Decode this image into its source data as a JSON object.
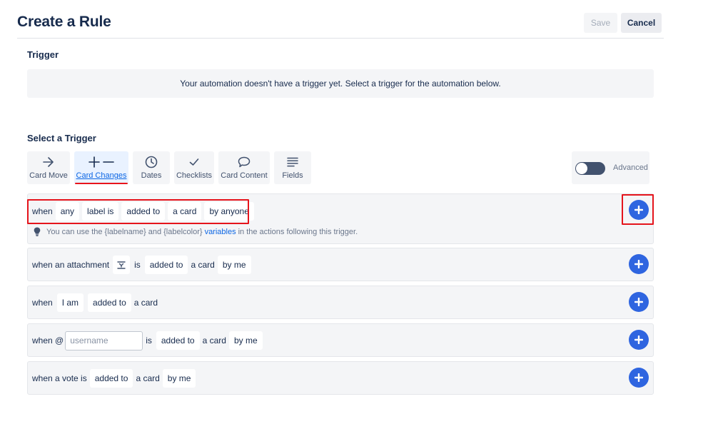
{
  "header": {
    "title": "Create a Rule",
    "save_label": "Save",
    "cancel_label": "Cancel"
  },
  "trigger": {
    "heading": "Trigger",
    "empty_message": "Your automation doesn't have a trigger yet. Select a trigger for the automation below."
  },
  "select_trigger": {
    "heading": "Select a Trigger",
    "tabs": [
      {
        "label": "Card Move",
        "icon": "arrow-right-icon",
        "active": false
      },
      {
        "label": "Card Changes",
        "icon": "plus-minus-icon",
        "active": true
      },
      {
        "label": "Dates",
        "icon": "clock-icon",
        "active": false
      },
      {
        "label": "Checklists",
        "icon": "checkmark-icon",
        "active": false
      },
      {
        "label": "Card Content",
        "icon": "speech-bubble-icon",
        "active": false
      },
      {
        "label": "Fields",
        "icon": "fields-list-icon",
        "active": false
      }
    ],
    "advanced_label": "Advanced",
    "advanced_enabled": false
  },
  "rows": [
    {
      "tokens": {
        "when": "when",
        "any": "any",
        "label_is": "label is",
        "added_to": "added to",
        "a_card": "a card",
        "by_anyone": "by anyone"
      },
      "hint": {
        "prefix": "You can use the {labelname} and {labelcolor}",
        "link": "variables",
        "suffix": "in the actions following this trigger."
      }
    },
    {
      "tokens": {
        "when_attachment": "when an attachment",
        "is": "is",
        "added_to": "added to",
        "a_card": "a card",
        "by_me": "by me"
      }
    },
    {
      "tokens": {
        "when": "when",
        "i_am": "I am",
        "added_to": "added to",
        "a_card": "a card"
      }
    },
    {
      "tokens": {
        "when_at": "when @",
        "username_placeholder": "username",
        "is": "is",
        "added_to": "added to",
        "a_card": "a card",
        "by_me": "by me"
      }
    },
    {
      "tokens": {
        "when_vote": "when a vote is",
        "added_to": "added to",
        "a_card": "a card",
        "by_me": "by me"
      }
    }
  ],
  "colors": {
    "accent_blue": "#2f65e0",
    "highlight_red": "#e5141c",
    "row_background": "#f4f5f7"
  }
}
